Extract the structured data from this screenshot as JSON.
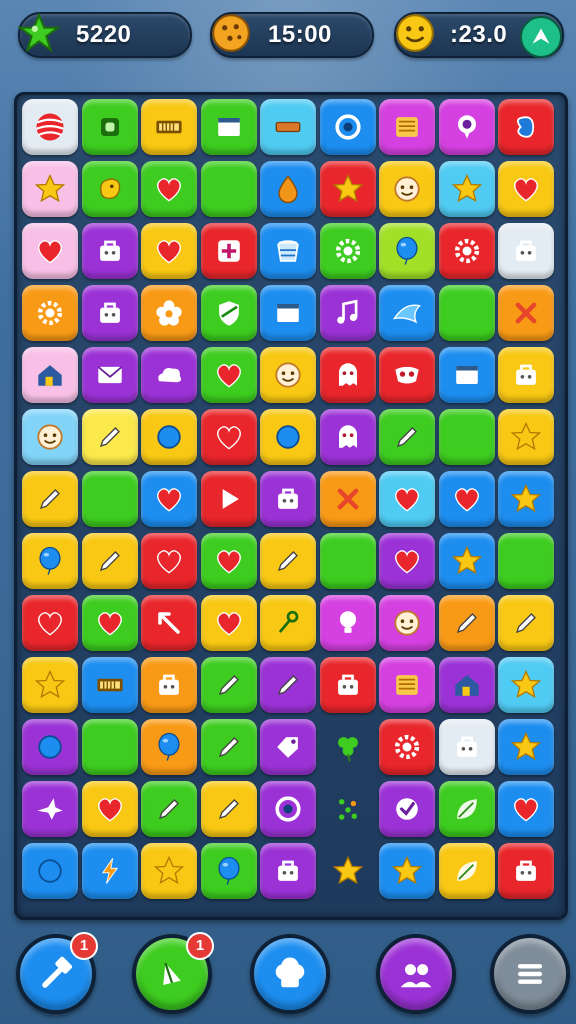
{
  "hud": {
    "score": {
      "icon": "star-icon",
      "value": "5220"
    },
    "timer": {
      "icon": "cookie-icon",
      "value": "15:00"
    },
    "bonus": {
      "icon": "smiley-icon",
      "value": ":23.0",
      "extra_icon": "leaf-icon"
    }
  },
  "colors": {
    "red": "#e8262b",
    "green": "#3dcc1f",
    "yellow": "#f8c814",
    "orange": "#f99a16",
    "purple": "#9b32d6",
    "magenta": "#d540e0",
    "blue": "#1d8ef0",
    "cyan": "#50cbf3",
    "pink": "#f8c0e6",
    "white": "#e4ecf3",
    "lime": "#a2e028",
    "lightyellow": "#fbe84a",
    "lightblue": "#82d4f9"
  },
  "board": {
    "rows": [
      [
        {
          "c": "white",
          "i": "ball"
        },
        {
          "c": "green",
          "i": "square"
        },
        {
          "c": "yellow",
          "i": "bars"
        },
        {
          "c": "green",
          "i": "window"
        },
        {
          "c": "cyan",
          "i": "bar"
        },
        {
          "c": "blue",
          "i": "ring"
        },
        {
          "c": "magenta",
          "i": "lines"
        },
        {
          "c": "magenta",
          "i": "pin"
        },
        {
          "c": "red",
          "i": "bean"
        }
      ],
      [
        {
          "c": "pink",
          "i": "star"
        },
        {
          "c": "green",
          "i": "blob"
        },
        {
          "c": "green",
          "i": "heart"
        },
        {
          "c": "green",
          "i": "none"
        },
        {
          "c": "blue",
          "i": "drop"
        },
        {
          "c": "red",
          "i": "star"
        },
        {
          "c": "yellow",
          "i": "face"
        },
        {
          "c": "cyan",
          "i": "star"
        },
        {
          "c": "yellow",
          "i": "heart"
        }
      ],
      [
        {
          "c": "pink",
          "i": "heart"
        },
        {
          "c": "purple",
          "i": "bag"
        },
        {
          "c": "yellow",
          "i": "heart"
        },
        {
          "c": "red",
          "i": "plus"
        },
        {
          "c": "blue",
          "i": "cup"
        },
        {
          "c": "green",
          "i": "gear"
        },
        {
          "c": "lime",
          "i": "balloon"
        },
        {
          "c": "red",
          "i": "gear"
        },
        {
          "c": "white",
          "i": "bag"
        }
      ],
      [
        {
          "c": "orange",
          "i": "gear"
        },
        {
          "c": "purple",
          "i": "bag"
        },
        {
          "c": "orange",
          "i": "flower"
        },
        {
          "c": "green",
          "i": "shield"
        },
        {
          "c": "blue",
          "i": "window"
        },
        {
          "c": "purple",
          "i": "note"
        },
        {
          "c": "blue",
          "i": "fish"
        },
        {
          "c": "green",
          "i": "none"
        },
        {
          "c": "orange",
          "i": "cross"
        }
      ],
      [
        {
          "c": "pink",
          "i": "house"
        },
        {
          "c": "purple",
          "i": "mail"
        },
        {
          "c": "purple",
          "i": "cloud"
        },
        {
          "c": "green",
          "i": "heart"
        },
        {
          "c": "yellow",
          "i": "face"
        },
        {
          "c": "red",
          "i": "ghost"
        },
        {
          "c": "red",
          "i": "mask"
        },
        {
          "c": "blue",
          "i": "window"
        },
        {
          "c": "yellow",
          "i": "bag"
        }
      ],
      [
        {
          "c": "lightblue",
          "i": "face"
        },
        {
          "c": "lightyellow",
          "i": "pencil"
        },
        {
          "c": "yellow",
          "i": "circle"
        },
        {
          "c": "red",
          "i": "heart"
        },
        {
          "c": "yellow",
          "i": "circle"
        },
        {
          "c": "purple",
          "i": "ghost"
        },
        {
          "c": "green",
          "i": "pencil"
        },
        {
          "c": "green",
          "i": "none"
        },
        {
          "c": "yellow",
          "i": "star"
        }
      ],
      [
        {
          "c": "yellow",
          "i": "pencil"
        },
        {
          "c": "green",
          "i": "none"
        },
        {
          "c": "blue",
          "i": "heart"
        },
        {
          "c": "red",
          "i": "play"
        },
        {
          "c": "purple",
          "i": "bag"
        },
        {
          "c": "orange",
          "i": "cross"
        },
        {
          "c": "cyan",
          "i": "heart"
        },
        {
          "c": "blue",
          "i": "heart"
        },
        {
          "c": "blue",
          "i": "star"
        }
      ],
      [
        {
          "c": "yellow",
          "i": "balloon"
        },
        {
          "c": "yellow",
          "i": "pencil"
        },
        {
          "c": "red",
          "i": "heart"
        },
        {
          "c": "green",
          "i": "heart"
        },
        {
          "c": "yellow",
          "i": "pencil"
        },
        {
          "c": "green",
          "i": "none"
        },
        {
          "c": "purple",
          "i": "heart"
        },
        {
          "c": "blue",
          "i": "star"
        },
        {
          "c": "green",
          "i": "none"
        }
      ],
      [
        {
          "c": "red",
          "i": "heart"
        },
        {
          "c": "green",
          "i": "heart"
        },
        {
          "c": "red",
          "i": "arrow"
        },
        {
          "c": "yellow",
          "i": "heart"
        },
        {
          "c": "yellow",
          "i": "key"
        },
        {
          "c": "magenta",
          "i": "bulb"
        },
        {
          "c": "magenta",
          "i": "face"
        },
        {
          "c": "orange",
          "i": "pencil"
        },
        {
          "c": "yellow",
          "i": "pencil"
        }
      ],
      [
        {
          "c": "yellow",
          "i": "star"
        },
        {
          "c": "blue",
          "i": "bars"
        },
        {
          "c": "orange",
          "i": "bag"
        },
        {
          "c": "green",
          "i": "pencil"
        },
        {
          "c": "purple",
          "i": "pencil"
        },
        {
          "c": "red",
          "i": "bag"
        },
        {
          "c": "magenta",
          "i": "lines"
        },
        {
          "c": "purple",
          "i": "house"
        },
        {
          "c": "cyan",
          "i": "star"
        }
      ],
      [
        {
          "c": "purple",
          "i": "circle"
        },
        {
          "c": "green",
          "i": "none"
        },
        {
          "c": "orange",
          "i": "balloon"
        },
        {
          "c": "green",
          "i": "pencil"
        },
        {
          "c": "purple",
          "i": "tag"
        },
        {
          "c": "empty",
          "i": "clover"
        },
        {
          "c": "red",
          "i": "gear"
        },
        {
          "c": "white",
          "i": "bag"
        },
        {
          "c": "blue",
          "i": "star"
        }
      ],
      [
        {
          "c": "purple",
          "i": "bird"
        },
        {
          "c": "yellow",
          "i": "heart"
        },
        {
          "c": "green",
          "i": "pencil"
        },
        {
          "c": "yellow",
          "i": "pencil"
        },
        {
          "c": "purple",
          "i": "ring"
        },
        {
          "c": "empty",
          "i": "dots"
        },
        {
          "c": "purple",
          "i": "check"
        },
        {
          "c": "green",
          "i": "leaf"
        },
        {
          "c": "blue",
          "i": "heart"
        }
      ],
      [
        {
          "c": "blue",
          "i": "circle"
        },
        {
          "c": "blue",
          "i": "bolt"
        },
        {
          "c": "yellow",
          "i": "star"
        },
        {
          "c": "green",
          "i": "balloon"
        },
        {
          "c": "purple",
          "i": "bag"
        },
        {
          "c": "empty",
          "i": "star"
        },
        {
          "c": "blue",
          "i": "star"
        },
        {
          "c": "yellow",
          "i": "leaf"
        },
        {
          "c": "red",
          "i": "bag"
        }
      ]
    ]
  },
  "bottom_bar": [
    {
      "name": "hammer-button",
      "icon": "hammer-icon",
      "color": "#1d8ef0",
      "badge": "1"
    },
    {
      "name": "wand-button",
      "icon": "wand-icon",
      "color": "#3dcc1f",
      "badge": "1"
    },
    {
      "name": "chef-hat-button",
      "icon": "chef-hat-icon",
      "color": "#1d8ef0",
      "badge": ""
    },
    {
      "name": "friends-button",
      "icon": "friends-icon",
      "color": "#9b32d6",
      "badge": ""
    },
    {
      "name": "menu-button",
      "icon": "menu-icon",
      "color": "#7f8c99",
      "badge": ""
    }
  ]
}
